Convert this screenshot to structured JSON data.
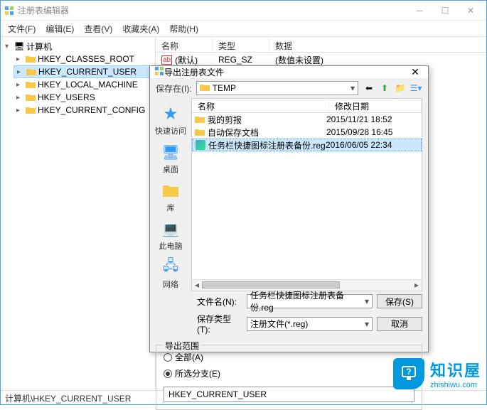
{
  "window": {
    "title": "注册表编辑器",
    "menus": [
      "文件(F)",
      "编辑(E)",
      "查看(V)",
      "收藏夹(A)",
      "帮助(H)"
    ]
  },
  "tree": {
    "root": "计算机",
    "items": [
      "HKEY_CLASSES_ROOT",
      "HKEY_CURRENT_USER",
      "HKEY_LOCAL_MACHINE",
      "HKEY_USERS",
      "HKEY_CURRENT_CONFIG"
    ],
    "selected": "HKEY_CURRENT_USER"
  },
  "list": {
    "headers": [
      "名称",
      "类型",
      "数据"
    ],
    "row": {
      "name": "(默认)",
      "type": "REG_SZ",
      "data": "(数值未设置)"
    }
  },
  "statusbar": "计算机\\HKEY_CURRENT_USER",
  "dialog": {
    "title": "导出注册表文件",
    "save_in_label": "保存在(I):",
    "save_in_value": "TEMP",
    "file_headers": {
      "name": "名称",
      "date": "修改日期"
    },
    "places": [
      "快速访问",
      "桌面",
      "库",
      "此电脑",
      "网络"
    ],
    "files": [
      {
        "name": "我的剪报",
        "date": "2015/11/21 18:52",
        "type": "folder"
      },
      {
        "name": "自动保存文档",
        "date": "2015/09/28 16:45",
        "type": "folder"
      },
      {
        "name": "任务栏快捷图标注册表备份.reg",
        "date": "2016/06/05 22:34",
        "type": "reg",
        "selected": true
      }
    ],
    "filename_label": "文件名(N):",
    "filename_value": "任务栏快捷图标注册表备份.reg",
    "filetype_label": "保存类型(T):",
    "filetype_value": "注册文件(*.reg)",
    "save_btn": "保存(S)",
    "cancel_btn": "取消",
    "export_legend": "导出范围",
    "radio_all": "全部(A)",
    "radio_branch": "所选分支(E)",
    "branch_value": "HKEY_CURRENT_USER"
  },
  "watermark": {
    "cn": "知识屋",
    "url": "zhishiwu.com"
  }
}
